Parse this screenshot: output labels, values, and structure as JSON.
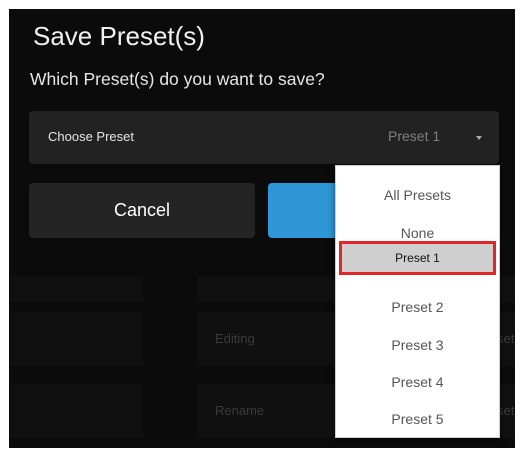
{
  "dialog": {
    "title": "Save Preset(s)",
    "question": "Which Preset(s) do you want to save?"
  },
  "chooser": {
    "label": "Choose Preset",
    "selected_value": "Preset 1"
  },
  "buttons": {
    "cancel_label": "Cancel"
  },
  "dropdown": {
    "options": [
      "All Presets",
      "None",
      "Preset 1",
      "Preset 2",
      "Preset 3",
      "Preset 4",
      "Preset 5"
    ],
    "highlighted": "Preset 1"
  },
  "background": {
    "row1_label": "Editing",
    "row2_label": "Rename",
    "row1_trailing": "set",
    "row2_trailing": "set"
  },
  "colors": {
    "background": "#0b0b0b",
    "dialog_field": "#222222",
    "accent_blue": "#2e96d4",
    "highlight_border": "#e0262b"
  }
}
